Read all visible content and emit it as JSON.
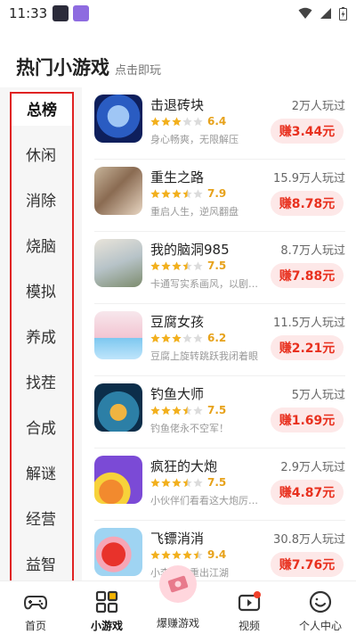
{
  "status_bar": {
    "time": "11:33"
  },
  "header": {
    "title": "热门小游戏",
    "subtitle": "点击即玩"
  },
  "categories": [
    "总榜",
    "休闲",
    "消除",
    "烧脑",
    "模拟",
    "养成",
    "找茬",
    "合成",
    "解谜",
    "经营",
    "益智"
  ],
  "active_category": "总榜",
  "games": [
    {
      "name": "击退砖块",
      "rating": "6.4",
      "stars": 3,
      "desc": "身心畅爽，无限解压",
      "players": "2万人玩过",
      "earn": "赚3.44元"
    },
    {
      "name": "重生之路",
      "rating": "7.9",
      "stars": 3.5,
      "desc": "重启人生，逆风翻盘",
      "players": "15.9万人玩过",
      "earn": "赚8.78元"
    },
    {
      "name": "我的脑洞985",
      "rating": "7.5",
      "stars": 3.5,
      "desc": "卡通写实系画风，以剧情...",
      "players": "8.7万人玩过",
      "earn": "赚7.88元"
    },
    {
      "name": "豆腐女孩",
      "rating": "6.2",
      "stars": 3,
      "desc": "豆腐上旋转跳跃我闭着眼",
      "players": "11.5万人玩过",
      "earn": "赚2.21元"
    },
    {
      "name": "钓鱼大师",
      "rating": "7.5",
      "stars": 3.5,
      "desc": "钓鱼佬永不空军！",
      "players": "5万人玩过",
      "earn": "赚1.69元"
    },
    {
      "name": "疯狂的大炮",
      "rating": "7.5",
      "stars": 3.5,
      "desc": "小伙伴们看看这大炮厉不...",
      "players": "2.9万人玩过",
      "earn": "赚4.87元"
    },
    {
      "name": "飞镖消消",
      "rating": "9.4",
      "stars": 4.5,
      "desc": "小李飞刀重出江湖",
      "players": "30.8万人玩过",
      "earn": "赚7.76元"
    }
  ],
  "bottom_nav": [
    {
      "label": "首页",
      "icon": "gamepad-icon"
    },
    {
      "label": "小游戏",
      "icon": "grid-icon"
    },
    {
      "label": "爆赚游戏",
      "icon": "money-icon"
    },
    {
      "label": "视频",
      "icon": "video-icon"
    },
    {
      "label": "个人中心",
      "icon": "smiley-icon"
    }
  ],
  "colors": {
    "accent": "#e8301e",
    "star": "#f2b01e",
    "earn_bg": "#fde8e8",
    "highlight_border": "#e02323"
  }
}
